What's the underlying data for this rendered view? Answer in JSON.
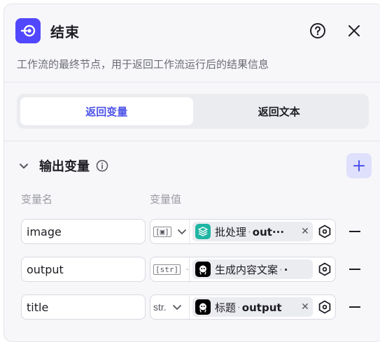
{
  "header": {
    "title": "结束",
    "description": "工作流的最终节点，用于返回工作流运行后的结果信息",
    "node_icon": "end-node-icon",
    "help_icon": "help-circle-icon",
    "close_icon": "close-icon"
  },
  "tabs": [
    {
      "label": "返回变量",
      "active": true
    },
    {
      "label": "返回文本",
      "active": false
    }
  ],
  "section": {
    "title": "输出变量",
    "column_name": "变量名",
    "column_value": "变量值"
  },
  "rows": [
    {
      "name": "image",
      "type_label": "[▣]",
      "ref_node": "批处理",
      "ref_output": "out···",
      "ref_icon": "layers-icon"
    },
    {
      "name": "output",
      "type_label": "[str]",
      "ref_node": "生成内容文案",
      "ref_output": "·",
      "ref_icon": "bot-icon"
    },
    {
      "name": "title",
      "type_label": "str.",
      "ref_node": "标题",
      "ref_output": "output",
      "ref_icon": "bot-icon"
    }
  ],
  "colors": {
    "accent": "#4d53e8",
    "node_icon_bg": "#5147ff",
    "batch_icon_bg": "#1fb5a3",
    "bot_icon_bg": "#000000"
  }
}
